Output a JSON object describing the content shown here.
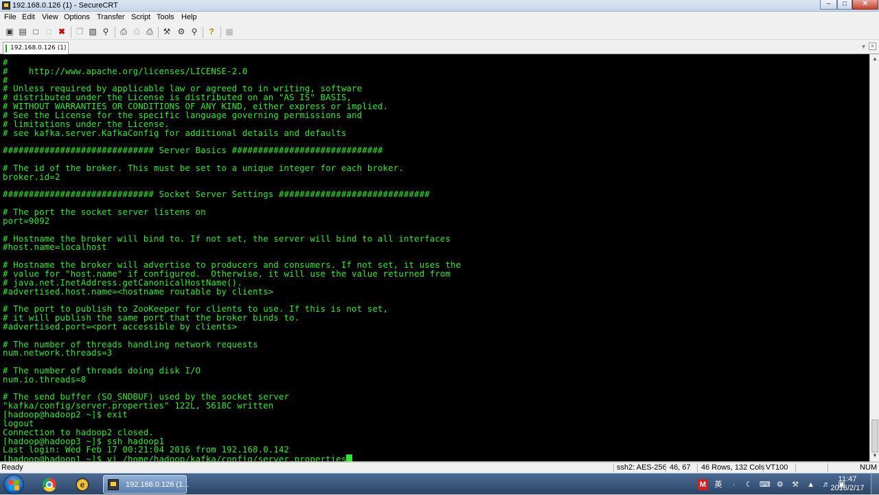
{
  "window": {
    "title": "192.168.0.126 (1) - SecureCRT"
  },
  "menu": [
    "File",
    "Edit",
    "View",
    "Options",
    "Transfer",
    "Script",
    "Tools",
    "Help"
  ],
  "toolbar": {
    "icons": [
      "connect-icon",
      "quick-connect-icon",
      "connect-in-tab-icon",
      "reconnect-icon",
      "disconnect-icon",
      "copy-icon",
      "paste-icon",
      "find-icon",
      "print-screen-icon",
      "print-selection-icon",
      "print-icon",
      "session-options-icon",
      "global-options-icon",
      "keymap-icon",
      "help-icon",
      "sftp-icon"
    ]
  },
  "tab": {
    "label": "192.168.0.126  (1)"
  },
  "terminal": {
    "lines": [
      "#",
      "#    http://www.apache.org/licenses/LICENSE-2.0",
      "#",
      "# Unless required by applicable law or agreed to in writing, software",
      "# distributed under the License is distributed on an \"AS IS\" BASIS,",
      "# WITHOUT WARRANTIES OR CONDITIONS OF ANY KIND, either express or implied.",
      "# See the License for the specific language governing permissions and",
      "# limitations under the License.",
      "# see kafka.server.KafkaConfig for additional details and defaults",
      "",
      "############################# Server Basics #############################",
      "",
      "# The id of the broker. This must be set to a unique integer for each broker.",
      "broker.id=2",
      "",
      "############################# Socket Server Settings #############################",
      "",
      "# The port the socket server listens on",
      "port=9092",
      "",
      "# Hostname the broker will bind to. If not set, the server will bind to all interfaces",
      "#host.name=localhost",
      "",
      "# Hostname the broker will advertise to producers and consumers. If not set, it uses the",
      "# value for \"host.name\" if configured.  Otherwise, it will use the value returned from",
      "# java.net.InetAddress.getCanonicalHostName().",
      "#advertised.host.name=<hostname routable by clients>",
      "",
      "# The port to publish to ZooKeeper for clients to use. If this is not set,",
      "# it will publish the same port that the broker binds to.",
      "#advertised.port=<port accessible by clients>",
      "",
      "# The number of threads handling network requests",
      "num.network.threads=3",
      "",
      "# The number of threads doing disk I/O",
      "num.io.threads=8",
      "",
      "# The send buffer (SO_SNDBUF) used by the socket server",
      "\"kafka/config/server.properties\" 122L, 5618C written",
      "[hadoop@hadoop2 ~]$ exit",
      "logout",
      "Connection to hadoop2 closed.",
      "[hadoop@hadoop3 ~]$ ssh hadoop1",
      "Last login: Wed Feb 17 00:21:04 2016 from 192.168.0.142",
      "[hadoop@hadoop1 ~]$ vi /home/hadoop/kafka/config/server.properties"
    ]
  },
  "status": {
    "ready": "Ready",
    "encryption": "ssh2: AES-256",
    "cursor_pos": "46,  67",
    "dimensions": "46 Rows, 132 Cols",
    "terminal_type": "VT100",
    "num": "NUM"
  },
  "taskbar": {
    "active_task": "192.168.0.126 (1...",
    "time": "11:47",
    "date": "2016/2/17",
    "ime": "M",
    "ime_lang": "英"
  }
}
